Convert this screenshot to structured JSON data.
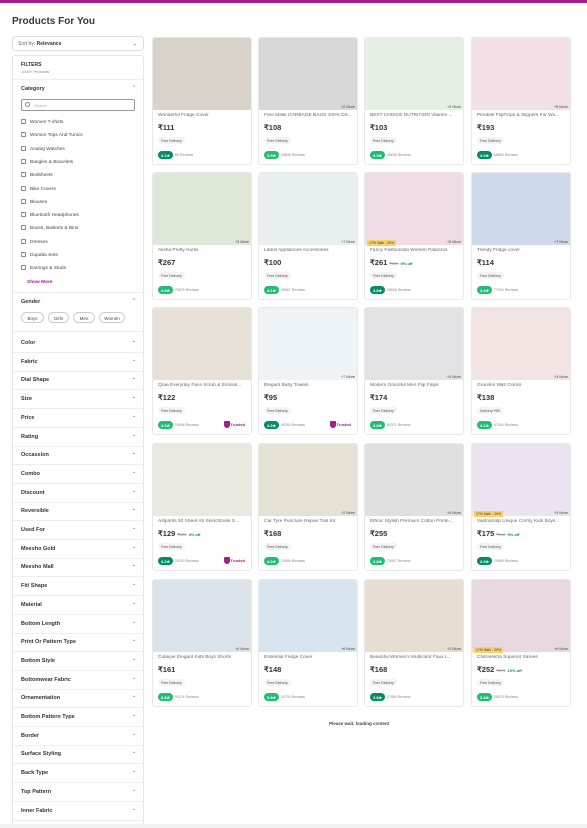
{
  "page": {
    "title": "Products For You",
    "sort_prefix": "Sort by:",
    "sort_value": "Relevance",
    "loading": "Please wait, loading content"
  },
  "filters": {
    "title": "FILTERS",
    "subtitle": "1000+ Products",
    "category_label": "Category",
    "search_placeholder": "Search",
    "categories": [
      "Women T-shirts",
      "Women Tops And Tunics",
      "Analog Watches",
      "Bangles & Bracelets",
      "Bedsheets",
      "Bike Covers",
      "Blouses",
      "Bluetooth Headphones",
      "Boxes, Baskets & Bins",
      "Dresses",
      "Dupatta Sets",
      "Earrings & Studs"
    ],
    "show_more": "Show More",
    "gender_label": "Gender",
    "genders": [
      "Boys",
      "Girls",
      "Men",
      "Women"
    ],
    "sections": [
      "Color",
      "Fabric",
      "Dial Shape",
      "Size",
      "Price",
      "Rating",
      "Occassion",
      "Combo",
      "Discount",
      "Reversible",
      "Used For",
      "Meesho Gold",
      "Meesho Mall",
      "Fit/ Shape",
      "Material",
      "Bottom Length",
      "Print Or Pattern Type",
      "Bottom Style",
      "Bottomwear Fabric",
      "Ornamentation",
      "Bottom Pattern Type",
      "Border",
      "Surface Styling",
      "Back Type",
      "Top Pattern",
      "Inner Fabric"
    ]
  },
  "products": [
    {
      "name": "Wonderful Fridge Cover",
      "price": "₹111",
      "delivery": "Free Delivery",
      "rating": "4.1★",
      "reviews": "56 Reviews",
      "more": "",
      "tag": "",
      "old": "",
      "off": "",
      "trusted": ""
    },
    {
      "name": "Free Mask GARBAGE BAGS 100% DX...",
      "price": "₹108",
      "delivery": "Free Delivery",
      "rating": "3.9★",
      "reviews": "65898 Reviews",
      "more": "+2 More",
      "tag": "",
      "old": "",
      "off": "",
      "trusted": ""
    },
    {
      "name": "BEST CHOICE NUTRITION Vitamin ...",
      "price": "₹103",
      "delivery": "Free Delivery",
      "rating": "4.3★",
      "reviews": "26835 Reviews",
      "more": "+3 More",
      "tag": "",
      "old": "",
      "off": "",
      "trusted": ""
    },
    {
      "name": "Pitrobile FlipFlops & Slippers For Wo...",
      "price": "₹193",
      "delivery": "Free Delivery",
      "rating": "4.0★",
      "reviews": "68883 Reviews",
      "more": "+5 More",
      "tag": "",
      "old": "",
      "off": "",
      "trusted": ""
    },
    {
      "name": "Alisha Pretty Kurtis",
      "price": "₹267",
      "delivery": "Free Delivery",
      "rating": "4.0★",
      "reviews": "75875 Reviews",
      "more": "+3 More",
      "tag": "",
      "old": "",
      "off": "",
      "trusted": ""
    },
    {
      "name": "Latest Appliances Accessories",
      "price": "₹100",
      "delivery": "Free Delivery",
      "rating": "4.1★",
      "reviews": "35397 Reviews",
      "more": "+7 More",
      "tag": "",
      "old": "",
      "off": "",
      "trusted": ""
    },
    {
      "name": "Fancy Fashionista Women Palazzos",
      "price": "₹261",
      "delivery": "Free Delivery",
      "rating": "3.8★",
      "reviews": "28506 Reviews",
      "more": "+5 More",
      "tag": "17% Sale - 20%",
      "old": "₹303",
      "off": "9% off",
      "trusted": ""
    },
    {
      "name": "Trendy Fridge cover",
      "price": "₹114",
      "delivery": "Free Delivery",
      "rating": "3.9★",
      "reviews": "77994 Reviews",
      "more": "+7 More",
      "tag": "",
      "old": "",
      "off": "",
      "trusted": ""
    },
    {
      "name": "Qraa Everyday Face Scrub & Exfoliat...",
      "price": "₹122",
      "delivery": "Free Delivery",
      "rating": "4.0★",
      "reviews": "15806 Reviews",
      "more": "",
      "tag": "",
      "old": "",
      "off": "",
      "trusted": "Trusted"
    },
    {
      "name": "Elegant Baby Towels",
      "price": "₹95",
      "delivery": "Free Delivery",
      "rating": "4.3★",
      "reviews": "45763 Reviews",
      "more": "+7 More",
      "tag": "",
      "old": "",
      "off": "",
      "trusted": "Trusted"
    },
    {
      "name": "Modern Graceful Men Flip Flops",
      "price": "₹174",
      "delivery": "Free Delivery",
      "rating": "3.8★",
      "reviews": "60371 Reviews",
      "more": "+4 More",
      "tag": "",
      "old": "",
      "off": "",
      "trusted": ""
    },
    {
      "name": "Graceful Wall Clocks",
      "price": "₹138",
      "delivery": "Delivery ₹59",
      "rating": "4.1★",
      "reviews": "97034 Reviews",
      "more": "+3 More",
      "tag": "",
      "old": "",
      "off": "",
      "trusted": ""
    },
    {
      "name": "Astprints 50 Sheet A5 Sketchbook S...",
      "price": "₹129",
      "delivery": "Free Delivery",
      "rating": "4.2★",
      "reviews": "20153 Reviews",
      "more": "",
      "tag": "",
      "old": "₹134",
      "off": "4% off",
      "trusted": "Trusted"
    },
    {
      "name": "Car Tyre Puncture Repair Tool Kit",
      "price": "₹168",
      "delivery": "Free Delivery",
      "rating": "4.0★",
      "reviews": "14896 Reviews",
      "more": "+2 More",
      "tag": "",
      "old": "",
      "off": "",
      "trusted": ""
    },
    {
      "name": "Ethnic Stylish Premium Cotton Printe...",
      "price": "₹255",
      "delivery": "Free Delivery",
      "rating": "3.8★",
      "reviews": "79067 Reviews",
      "more": "+4 More",
      "tag": "",
      "old": "",
      "off": "",
      "trusted": ""
    },
    {
      "name": "Vastramlap Unique Comfy Kids Boys...",
      "price": "₹175",
      "delivery": "Free Delivery",
      "rating": "3.9★",
      "reviews": "19668 Reviews",
      "more": "+3 More",
      "tag": "17% Sale - 20%",
      "old": "₹192",
      "off": "9% off",
      "trusted": ""
    },
    {
      "name": "Cutiepie Elegant Kids Boys Shorts",
      "price": "₹161",
      "delivery": "Free Delivery",
      "rating": "3.8★",
      "reviews": "91174 Reviews",
      "more": "+4 More",
      "tag": "",
      "old": "",
      "off": "",
      "trusted": ""
    },
    {
      "name": "Essential Fridge Cover",
      "price": "₹148",
      "delivery": "Free Delivery",
      "rating": "3.9★",
      "reviews": "20793 Reviews",
      "more": "+6 More",
      "tag": "",
      "old": "",
      "off": "",
      "trusted": ""
    },
    {
      "name": "Beautiful Women's Multicolor Faux L...",
      "price": "₹168",
      "delivery": "Free Delivery",
      "rating": "3.8★",
      "reviews": "47866 Reviews",
      "more": "+2 More",
      "tag": "",
      "old": "",
      "off": "",
      "trusted": ""
    },
    {
      "name": "Chitrarekha Superior Sarees",
      "price": "₹252",
      "delivery": "Free Delivery",
      "rating": "3.8★",
      "reviews": "28075 Reviews",
      "more": "+6 More",
      "tag": "17% Sale - 20%",
      "old": "₹279",
      "off": "10% off",
      "trusted": ""
    }
  ]
}
